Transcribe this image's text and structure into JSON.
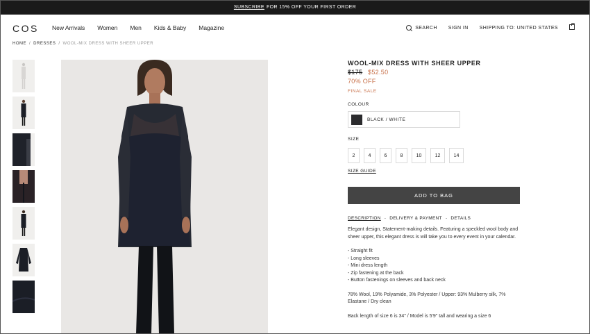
{
  "promo": {
    "link_text": "SUBSCRIBE",
    "text": "FOR 15% OFF YOUR FIRST ORDER"
  },
  "header": {
    "logo": "COS",
    "nav": [
      "New Arrivals",
      "Women",
      "Men",
      "Kids & Baby",
      "Magazine"
    ],
    "search_label": "SEARCH",
    "sign_in_label": "SIGN IN",
    "shipping_label": "SHIPPING TO: UNITED STATES"
  },
  "breadcrumb": {
    "items": [
      "HOME",
      "DRESSES"
    ],
    "current": "WOOL-MIX DRESS WITH SHEER UPPER"
  },
  "thumbnails": [
    {
      "style": "light",
      "label": "front-view-light"
    },
    {
      "style": "light",
      "label": "front-view"
    },
    {
      "style": "light",
      "label": "sleeve-detail"
    },
    {
      "style": "light",
      "label": "back-detail"
    },
    {
      "style": "light",
      "label": "back-view"
    },
    {
      "style": "light",
      "label": "flat-lay"
    },
    {
      "style": "dark",
      "label": "fabric-detail"
    }
  ],
  "product": {
    "title": "WOOL-MIX DRESS WITH SHEER UPPER",
    "price_old": "$175",
    "price_new": "$52.50",
    "discount": "70% OFF",
    "final_sale": "FINAL SALE",
    "colour_label": "COLOUR",
    "colour_value": "BLACK / WHITE",
    "colour_swatch": "#2b2b2e",
    "size_label": "SIZE",
    "sizes": [
      "2",
      "4",
      "6",
      "8",
      "10",
      "12",
      "14"
    ],
    "size_guide": "SIZE GUIDE",
    "add_to_bag": "ADD TO BAG"
  },
  "tabs": {
    "description": "DESCRIPTION",
    "delivery": "DELIVERY & PAYMENT",
    "details": "DETAILS",
    "separator": "-"
  },
  "description": {
    "intro": "Elegant design, Statement-making details. Featuring a speckled wool body and sheer upper, this elegant dress is will take you to every event in your calendar.",
    "features": [
      "- Straight fit",
      "- Long sleeves",
      "- Mini dress length",
      "- Zip fastening at the back",
      "- Button fastenings on sleeves and back neck"
    ],
    "composition": "78% Wool, 19% Polyamide, 3% Polyester / Upper: 93% Mulberry silk, 7% Elastane / Dry clean",
    "fit": "Back length of size 6 is 34\" / Model is 5'9\" tall and wearing a size 6"
  },
  "colors": {
    "accent_sale": "#c8714a",
    "button_bg": "#444444",
    "promo_bg": "#1a1a1a"
  }
}
